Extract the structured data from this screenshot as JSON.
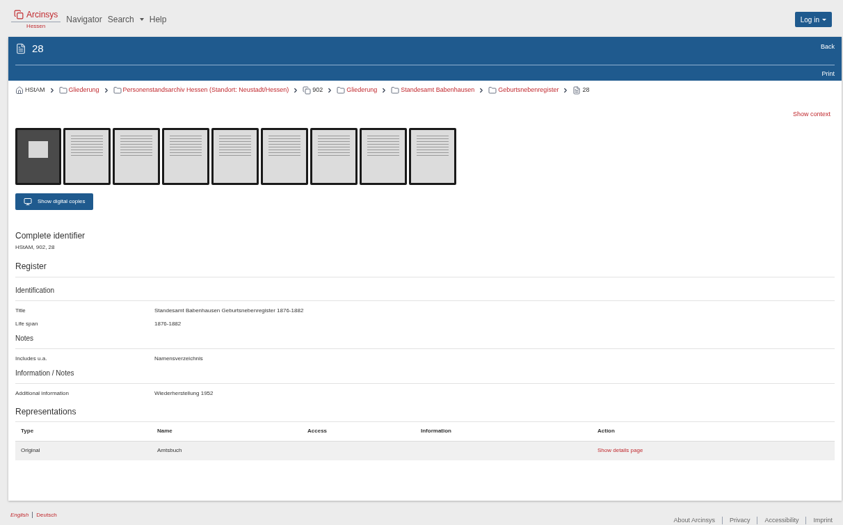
{
  "header": {
    "logo": {
      "name": "Arcinsys",
      "region": "Hessen"
    },
    "nav": [
      {
        "label": "Navigator",
        "dropdown": false
      },
      {
        "label": "Search",
        "dropdown": true
      },
      {
        "label": "Help",
        "dropdown": false
      }
    ],
    "login": "Log in"
  },
  "title_bar": {
    "title": "28",
    "actions": [
      "Back",
      "Print"
    ]
  },
  "breadcrumb": [
    {
      "label": "HStAM",
      "kind": "home",
      "link": false
    },
    {
      "label": "Gliederung",
      "kind": "folder",
      "link": true
    },
    {
      "label": "Personenstandsarchiv Hessen (Standort: Neustadt/Hessen)",
      "kind": "folder",
      "link": true
    },
    {
      "label": "902",
      "kind": "volume",
      "link": false
    },
    {
      "label": "Gliederung",
      "kind": "folder",
      "link": true
    },
    {
      "label": "Standesamt Babenhausen",
      "kind": "folder",
      "link": true
    },
    {
      "label": "Geburtsnebenregister",
      "kind": "folder",
      "link": true
    },
    {
      "label": "28",
      "kind": "document",
      "link": false
    }
  ],
  "show_context": "Show context",
  "thumbnails": [
    {
      "kind": "cover"
    },
    {
      "kind": "page"
    },
    {
      "kind": "page"
    },
    {
      "kind": "page"
    },
    {
      "kind": "page"
    },
    {
      "kind": "page"
    },
    {
      "kind": "page"
    },
    {
      "kind": "page"
    },
    {
      "kind": "page"
    }
  ],
  "digital_copies_button": "Show digital copies",
  "complete_identifier": {
    "heading": "Complete identifier",
    "value": "HStAM, 902, 28"
  },
  "register_heading": "Register",
  "groups": [
    {
      "heading": "Identification",
      "rows": [
        {
          "label": "Title",
          "value": "Standesamt Babenhausen Geburtsnebenregister 1876-1882"
        },
        {
          "label": "Life span",
          "value": "1876-1882"
        }
      ]
    },
    {
      "heading": "Notes",
      "rows": [
        {
          "label": "Includes u.a.",
          "value": "Namensverzeichnis"
        }
      ]
    },
    {
      "heading": "Information / Notes",
      "rows": [
        {
          "label": "Additional information",
          "value": "Wiederherstellung 1952"
        }
      ]
    }
  ],
  "representations": {
    "heading": "Representations",
    "columns": [
      "Type",
      "Name",
      "Access",
      "Information",
      "Action"
    ],
    "rows": [
      {
        "type": "Original",
        "name": "Amtsbuch",
        "action": "Show details page"
      }
    ]
  },
  "footer": {
    "languages": [
      {
        "label": "English",
        "selected": true
      },
      {
        "label": "Deutsch",
        "selected": false
      }
    ],
    "links": [
      "About Arcinsys",
      "Privacy",
      "Accessibility",
      "Imprint"
    ]
  }
}
